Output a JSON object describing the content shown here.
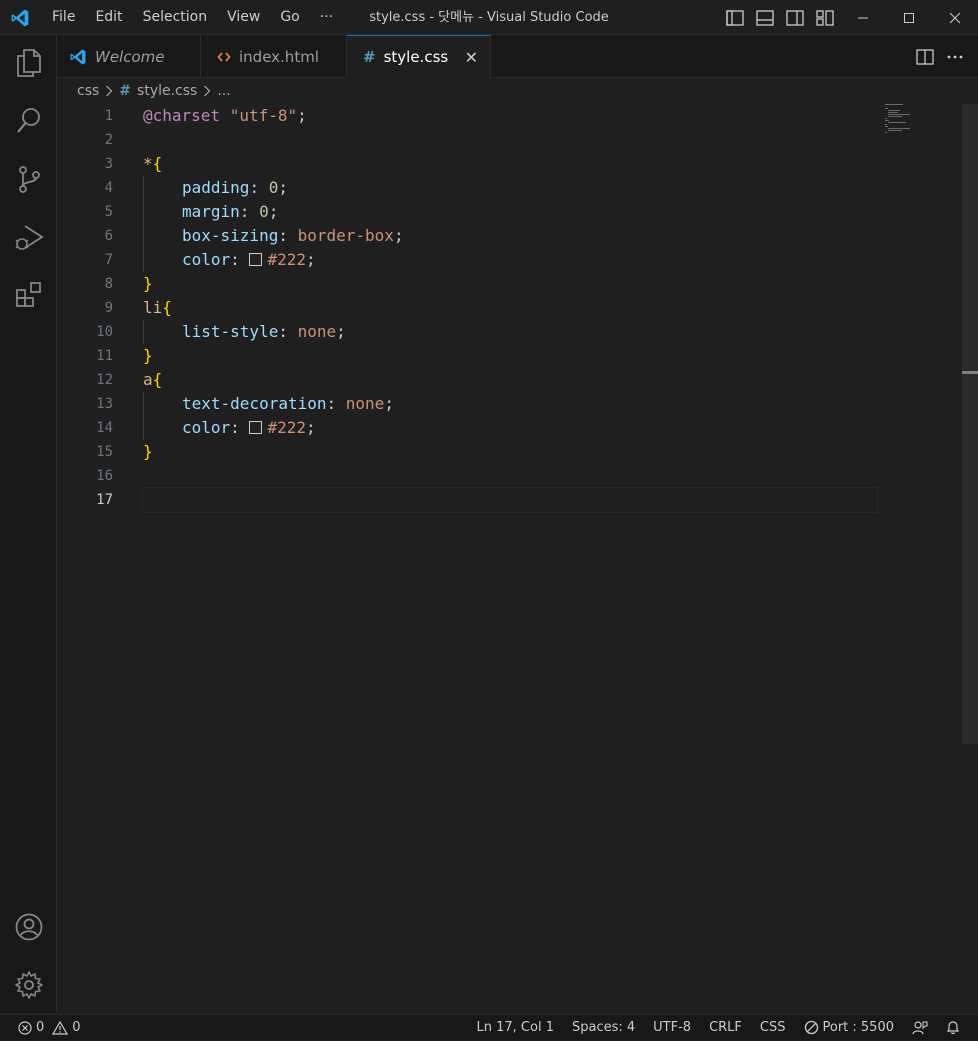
{
  "window": {
    "title": "style.css - 닷메뉴 - Visual Studio Code"
  },
  "menu": [
    {
      "label": "File"
    },
    {
      "label": "Edit"
    },
    {
      "label": "Selection"
    },
    {
      "label": "View"
    },
    {
      "label": "Go"
    },
    {
      "label": "···"
    }
  ],
  "tabs": [
    {
      "label": "Welcome",
      "icon": "vscode-logo-icon",
      "italic": true
    },
    {
      "label": "index.html",
      "icon": "html-icon"
    },
    {
      "label": "style.css",
      "icon": "hash-icon",
      "active": true,
      "close": "✕"
    }
  ],
  "breadcrumb": {
    "folder": "css",
    "file": "style.css",
    "more": "..."
  },
  "editor": {
    "current_line": 17,
    "line_numbers": [
      "1",
      "2",
      "3",
      "4",
      "5",
      "6",
      "7",
      "8",
      "9",
      "10",
      "11",
      "12",
      "13",
      "14",
      "15",
      "16",
      "17"
    ],
    "code": {
      "l1": {
        "at": "@charset",
        "str": "\"utf-8\"",
        "end": ";"
      },
      "l3": {
        "sel": "*",
        "br": "{"
      },
      "l4": {
        "prop": "padding",
        "colon": ":",
        "val": "0",
        "end": ";"
      },
      "l5": {
        "prop": "margin",
        "colon": ":",
        "val": "0",
        "end": ";"
      },
      "l6": {
        "prop": "box-sizing",
        "colon": ":",
        "val": "border-box",
        "end": ";"
      },
      "l7": {
        "prop": "color",
        "colon": ":",
        "val": "#222",
        "end": ";"
      },
      "l8": {
        "br": "}"
      },
      "l9": {
        "sel": "li",
        "br": "{"
      },
      "l10": {
        "prop": "list-style",
        "colon": ":",
        "val": "none",
        "end": ";"
      },
      "l11": {
        "br": "}"
      },
      "l12": {
        "sel": "a",
        "br": "{"
      },
      "l13": {
        "prop": "text-decoration",
        "colon": ":",
        "val": "none",
        "end": ";"
      },
      "l14": {
        "prop": "color",
        "colon": ":",
        "val": "#222",
        "end": ";"
      },
      "l15": {
        "br": "}"
      }
    }
  },
  "statusbar": {
    "errors": "0",
    "warnings": "0",
    "position": "Ln 17, Col 1",
    "spaces": "Spaces: 4",
    "encoding": "UTF-8",
    "eol": "CRLF",
    "language": "CSS",
    "port": "Port : 5500"
  },
  "colors": {
    "accent": "#0078d4",
    "vscode_blue": "#23a9f2",
    "html_orange": "#e37933",
    "css_hash": "#519aba",
    "swatch": "#222222"
  }
}
